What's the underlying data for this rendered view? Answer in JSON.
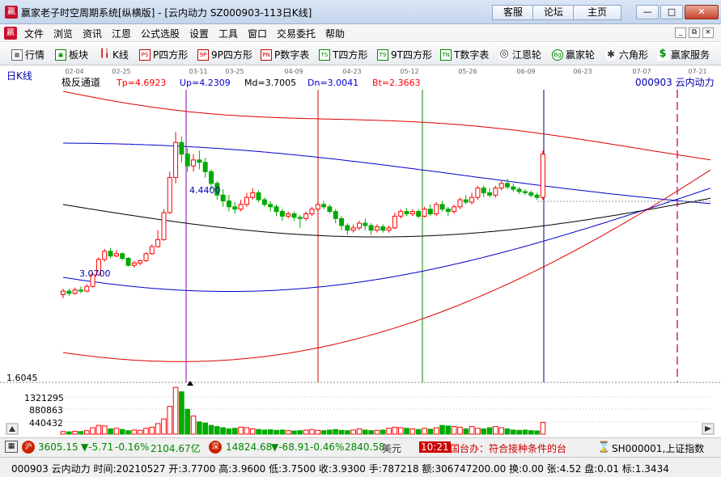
{
  "window": {
    "title": "赢家老子时空周期系统[纵横版] - [云内动力  SZ000903-113日K线]",
    "ext_buttons": [
      "客服",
      "论坛",
      "主页"
    ],
    "controls": [
      "—",
      "□",
      "✕"
    ]
  },
  "menu": {
    "items": [
      "文件",
      "浏览",
      "资讯",
      "江恩",
      "公式选股",
      "设置",
      "工具",
      "窗口",
      "交易委托",
      "帮助"
    ],
    "mdi": [
      "_",
      "⧉",
      "×"
    ]
  },
  "toolbar": {
    "items": [
      {
        "label": "行情",
        "icon": "grid-icon"
      },
      {
        "label": "板块",
        "icon": "blocks-icon"
      },
      {
        "label": "K线",
        "icon": "candles-icon"
      },
      {
        "label": "P四方形",
        "icon": "ps-icon",
        "icon_text": "PS"
      },
      {
        "label": "9P四方形",
        "icon": "9p-icon",
        "icon_text": "9P"
      },
      {
        "label": "P数字表",
        "icon": "pn-icon",
        "icon_text": "PN"
      },
      {
        "label": "T四方形",
        "icon": "ts-icon",
        "icon_text": "TS"
      },
      {
        "label": "9T四方形",
        "icon": "9t-icon",
        "icon_text": "T9"
      },
      {
        "label": "T数字表",
        "icon": "tn-icon",
        "icon_text": "TN"
      },
      {
        "label": "江恩轮",
        "icon": "gann-wheel-icon",
        "icon_text": "◎"
      },
      {
        "label": "赢家轮",
        "icon": "winner-wheel-icon",
        "icon_text": "Bg"
      },
      {
        "label": "六角形",
        "icon": "hexagon-icon",
        "icon_text": "✱"
      },
      {
        "label": "赢家服务",
        "icon": "dollar-icon",
        "icon_text": "$"
      }
    ]
  },
  "chart": {
    "period_label": "日K线",
    "indicator_name": "极反通道",
    "indicators": [
      {
        "label": "Tp=4.6923",
        "color": "#ff0000"
      },
      {
        "label": "Up=4.2309",
        "color": "#0000cc"
      },
      {
        "label": "Md=3.7005",
        "color": "#000000"
      },
      {
        "label": "Dn=3.0041",
        "color": "#0000cc"
      },
      {
        "label": "Bt=2.3663",
        "color": "#ff0000"
      }
    ],
    "stock_label": "000903  云内动力",
    "dates": [
      "02-04",
      "02-25",
      "03-11",
      "03-25",
      "04-09",
      "04-23",
      "05-12",
      "05-26",
      "06-09",
      "06-23",
      "07-07",
      "07-21"
    ],
    "high_marker": "4.4400",
    "low_marker": "3.0700",
    "volume_axis": [
      "1.6045",
      "1321295",
      "880863",
      "440432"
    ],
    "colors": {
      "up": "#ff0000",
      "down": "#00aa00",
      "upper_band": "#0000cc",
      "outer_band": "#dd0000",
      "mid_band": "#000000"
    }
  },
  "chart_data": {
    "type": "candlestick",
    "title": "云内动力 SZ000903 日K线",
    "candles": [
      {
        "o": 3.05,
        "c": 3.08,
        "h": 3.1,
        "l": 3.02
      },
      {
        "o": 3.08,
        "c": 3.06,
        "h": 3.1,
        "l": 3.04
      },
      {
        "o": 3.06,
        "c": 3.09,
        "h": 3.11,
        "l": 3.05
      },
      {
        "o": 3.09,
        "c": 3.08,
        "h": 3.12,
        "l": 3.06
      },
      {
        "o": 3.08,
        "c": 3.12,
        "h": 3.14,
        "l": 3.07
      },
      {
        "o": 3.12,
        "c": 3.22,
        "h": 3.24,
        "l": 3.11
      },
      {
        "o": 3.22,
        "c": 3.35,
        "h": 3.37,
        "l": 3.21
      },
      {
        "o": 3.35,
        "c": 3.42,
        "h": 3.44,
        "l": 3.33
      },
      {
        "o": 3.42,
        "c": 3.38,
        "h": 3.45,
        "l": 3.36
      },
      {
        "o": 3.38,
        "c": 3.4,
        "h": 3.43,
        "l": 3.37
      },
      {
        "o": 3.4,
        "c": 3.36,
        "h": 3.41,
        "l": 3.34
      },
      {
        "o": 3.36,
        "c": 3.3,
        "h": 3.37,
        "l": 3.29
      },
      {
        "o": 3.3,
        "c": 3.32,
        "h": 3.34,
        "l": 3.28
      },
      {
        "o": 3.32,
        "c": 3.34,
        "h": 3.35,
        "l": 3.3
      },
      {
        "o": 3.34,
        "c": 3.4,
        "h": 3.41,
        "l": 3.33
      },
      {
        "o": 3.4,
        "c": 3.46,
        "h": 3.48,
        "l": 3.39
      },
      {
        "o": 3.46,
        "c": 3.52,
        "h": 3.6,
        "l": 3.45
      },
      {
        "o": 3.52,
        "c": 3.75,
        "h": 3.78,
        "l": 3.51
      },
      {
        "o": 3.75,
        "c": 4.05,
        "h": 4.1,
        "l": 3.74
      },
      {
        "o": 4.05,
        "c": 4.35,
        "h": 4.44,
        "l": 4.0
      },
      {
        "o": 4.35,
        "c": 4.25,
        "h": 4.4,
        "l": 4.18
      },
      {
        "o": 4.25,
        "c": 4.15,
        "h": 4.3,
        "l": 4.1
      },
      {
        "o": 4.15,
        "c": 4.2,
        "h": 4.25,
        "l": 4.1
      },
      {
        "o": 4.2,
        "c": 4.18,
        "h": 4.28,
        "l": 4.12
      },
      {
        "o": 4.18,
        "c": 4.1,
        "h": 4.22,
        "l": 4.05
      },
      {
        "o": 4.1,
        "c": 4.0,
        "h": 4.12,
        "l": 3.95
      },
      {
        "o": 4.0,
        "c": 3.9,
        "h": 4.02,
        "l": 3.86
      },
      {
        "o": 3.9,
        "c": 3.85,
        "h": 3.95,
        "l": 3.8
      },
      {
        "o": 3.85,
        "c": 3.8,
        "h": 3.9,
        "l": 3.76
      },
      {
        "o": 3.8,
        "c": 3.78,
        "h": 3.84,
        "l": 3.74
      },
      {
        "o": 3.78,
        "c": 3.82,
        "h": 3.86,
        "l": 3.76
      },
      {
        "o": 3.82,
        "c": 3.88,
        "h": 3.92,
        "l": 3.8
      },
      {
        "o": 3.88,
        "c": 3.92,
        "h": 3.96,
        "l": 3.86
      },
      {
        "o": 3.92,
        "c": 3.86,
        "h": 3.94,
        "l": 3.84
      },
      {
        "o": 3.86,
        "c": 3.82,
        "h": 3.88,
        "l": 3.8
      },
      {
        "o": 3.82,
        "c": 3.8,
        "h": 3.85,
        "l": 3.76
      },
      {
        "o": 3.8,
        "c": 3.76,
        "h": 3.82,
        "l": 3.72
      },
      {
        "o": 3.76,
        "c": 3.72,
        "h": 3.78,
        "l": 3.68
      },
      {
        "o": 3.72,
        "c": 3.74,
        "h": 3.76,
        "l": 3.7
      },
      {
        "o": 3.74,
        "c": 3.71,
        "h": 3.76,
        "l": 3.68
      },
      {
        "o": 3.71,
        "c": 3.7,
        "h": 3.73,
        "l": 3.62
      },
      {
        "o": 3.7,
        "c": 3.74,
        "h": 3.76,
        "l": 3.68
      },
      {
        "o": 3.74,
        "c": 3.78,
        "h": 3.8,
        "l": 3.72
      },
      {
        "o": 3.78,
        "c": 3.82,
        "h": 3.84,
        "l": 3.76
      },
      {
        "o": 3.82,
        "c": 3.8,
        "h": 3.85,
        "l": 3.78
      },
      {
        "o": 3.8,
        "c": 3.76,
        "h": 3.82,
        "l": 3.74
      },
      {
        "o": 3.76,
        "c": 3.7,
        "h": 3.78,
        "l": 3.66
      },
      {
        "o": 3.7,
        "c": 3.64,
        "h": 3.72,
        "l": 3.6
      },
      {
        "o": 3.64,
        "c": 3.6,
        "h": 3.66,
        "l": 3.56
      },
      {
        "o": 3.6,
        "c": 3.62,
        "h": 3.65,
        "l": 3.58
      },
      {
        "o": 3.62,
        "c": 3.66,
        "h": 3.68,
        "l": 3.6
      },
      {
        "o": 3.66,
        "c": 3.64,
        "h": 3.7,
        "l": 3.6
      },
      {
        "o": 3.64,
        "c": 3.6,
        "h": 3.66,
        "l": 3.56
      },
      {
        "o": 3.6,
        "c": 3.63,
        "h": 3.65,
        "l": 3.58
      },
      {
        "o": 3.63,
        "c": 3.6,
        "h": 3.65,
        "l": 3.58
      },
      {
        "o": 3.6,
        "c": 3.62,
        "h": 3.64,
        "l": 3.58
      },
      {
        "o": 3.62,
        "c": 3.72,
        "h": 3.75,
        "l": 3.61
      },
      {
        "o": 3.72,
        "c": 3.76,
        "h": 3.78,
        "l": 3.7
      },
      {
        "o": 3.76,
        "c": 3.74,
        "h": 3.79,
        "l": 3.72
      },
      {
        "o": 3.74,
        "c": 3.76,
        "h": 3.78,
        "l": 3.72
      },
      {
        "o": 3.76,
        "c": 3.72,
        "h": 3.78,
        "l": 3.7
      },
      {
        "o": 3.72,
        "c": 3.78,
        "h": 3.8,
        "l": 3.71
      },
      {
        "o": 3.78,
        "c": 3.74,
        "h": 3.82,
        "l": 3.72
      },
      {
        "o": 3.74,
        "c": 3.82,
        "h": 3.84,
        "l": 3.72
      },
      {
        "o": 3.82,
        "c": 3.78,
        "h": 3.85,
        "l": 3.76
      },
      {
        "o": 3.78,
        "c": 3.76,
        "h": 3.8,
        "l": 3.72
      },
      {
        "o": 3.76,
        "c": 3.8,
        "h": 3.82,
        "l": 3.74
      },
      {
        "o": 3.8,
        "c": 3.86,
        "h": 3.88,
        "l": 3.78
      },
      {
        "o": 3.86,
        "c": 3.84,
        "h": 3.9,
        "l": 3.82
      },
      {
        "o": 3.84,
        "c": 3.88,
        "h": 3.92,
        "l": 3.82
      },
      {
        "o": 3.88,
        "c": 3.96,
        "h": 3.98,
        "l": 3.86
      },
      {
        "o": 3.96,
        "c": 3.92,
        "h": 3.98,
        "l": 3.88
      },
      {
        "o": 3.92,
        "c": 3.9,
        "h": 3.96,
        "l": 3.88
      },
      {
        "o": 3.9,
        "c": 3.96,
        "h": 3.98,
        "l": 3.88
      },
      {
        "o": 3.96,
        "c": 4.0,
        "h": 4.02,
        "l": 3.94
      },
      {
        "o": 4.0,
        "c": 3.97,
        "h": 4.04,
        "l": 3.95
      },
      {
        "o": 3.97,
        "c": 3.95,
        "h": 4.0,
        "l": 3.93
      },
      {
        "o": 3.95,
        "c": 3.93,
        "h": 3.97,
        "l": 3.91
      },
      {
        "o": 3.93,
        "c": 3.92,
        "h": 3.95,
        "l": 3.9
      },
      {
        "o": 3.92,
        "c": 3.9,
        "h": 3.94,
        "l": 3.88
      },
      {
        "o": 3.9,
        "c": 3.88,
        "h": 3.92,
        "l": 3.86
      },
      {
        "o": 3.88,
        "c": 4.25,
        "h": 4.28,
        "l": 3.86
      }
    ],
    "volumes": [
      0.09,
      0.08,
      0.1,
      0.09,
      0.12,
      0.22,
      0.3,
      0.28,
      0.18,
      0.2,
      0.16,
      0.12,
      0.14,
      0.13,
      0.2,
      0.24,
      0.36,
      0.52,
      0.95,
      1.6,
      1.45,
      0.85,
      0.62,
      0.42,
      0.38,
      0.3,
      0.26,
      0.22,
      0.18,
      0.2,
      0.24,
      0.22,
      0.18,
      0.16,
      0.14,
      0.15,
      0.13,
      0.14,
      0.12,
      0.11,
      0.12,
      0.14,
      0.16,
      0.13,
      0.12,
      0.14,
      0.16,
      0.13,
      0.12,
      0.14,
      0.18,
      0.14,
      0.12,
      0.13,
      0.14,
      0.2,
      0.24,
      0.22,
      0.2,
      0.18,
      0.16,
      0.2,
      0.17,
      0.22,
      0.3,
      0.28,
      0.26,
      0.24,
      0.18,
      0.26,
      0.2,
      0.18,
      0.22,
      0.26,
      0.22,
      0.18,
      0.14,
      0.13,
      0.14,
      0.12,
      0.11,
      0.4
    ],
    "ylim": [
      2.3,
      4.8
    ]
  },
  "status1": {
    "sh_index": "3605.15",
    "sh_change": "▼-5.71",
    "sh_pct": "-0.16%",
    "sh_amount": "2104.67亿",
    "sz_index": "14824.68",
    "sz_change": "▼-68.91",
    "sz_pct": "-0.46%",
    "sz_amount": "2840.58",
    "sz_unit": "美元",
    "time": "10:21",
    "news": "国台办：符合接种条件的台",
    "index_name": "SH000001,上证指数"
  },
  "status2": {
    "line": "000903 云内动力 时间:20210527 开:3.7700 高:3.9600 低:3.7500 收:3.9300 手:787218 额:306747200.00 换:0.00 张:4.52 盘:0.01 标:1.3434"
  }
}
